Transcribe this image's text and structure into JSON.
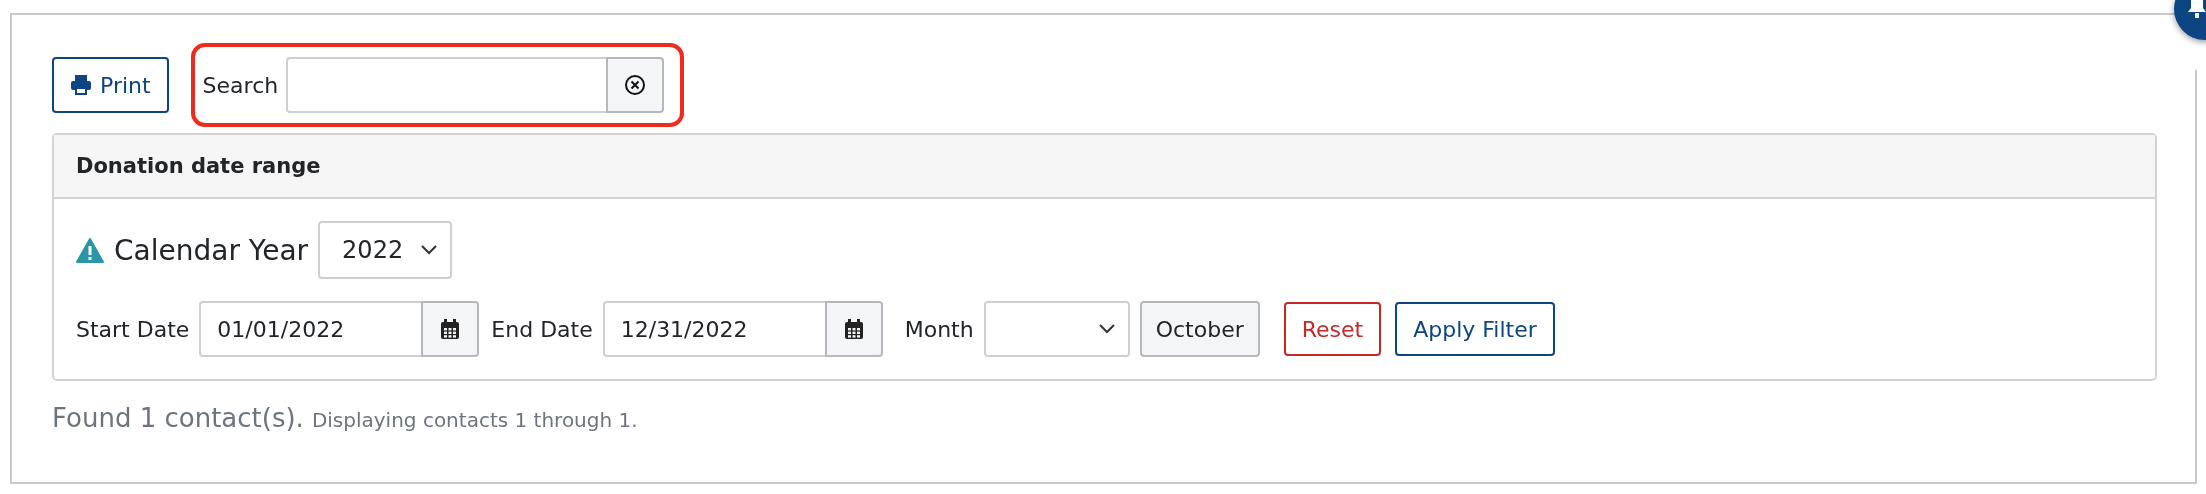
{
  "toolbar": {
    "print_button": {
      "label": "Print"
    },
    "search": {
      "label": "Search",
      "highlighted": true
    }
  },
  "panel": {
    "title": "Donation date range",
    "calendar_year": {
      "label": "Calendar Year",
      "value": "2022",
      "warning": true
    },
    "fields": [
      {
        "kind": "date",
        "label": "Start Date",
        "value": "01/01/2022"
      },
      {
        "kind": "date",
        "label": "End Date",
        "value": "12/31/2022"
      },
      {
        "kind": "select",
        "label": "Month"
      }
    ],
    "month_button": "October",
    "buttons": [
      {
        "label": "Reset",
        "kind": "danger"
      },
      {
        "label": "Apply Filter",
        "kind": "primary"
      }
    ]
  },
  "status": {
    "summary": "Found 1 contact(s).",
    "detail": "Displaying contacts 1 through 1."
  }
}
